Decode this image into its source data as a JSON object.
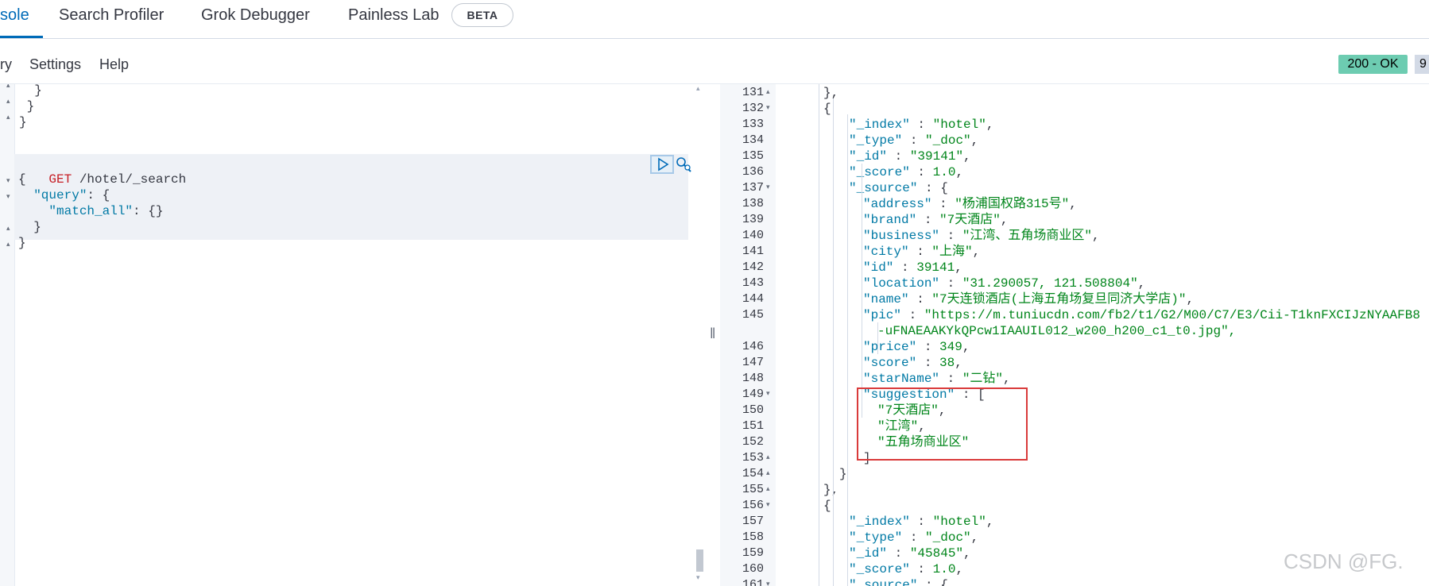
{
  "tabs": {
    "console": "sole",
    "search_profiler": "Search Profiler",
    "grok_debugger": "Grok Debugger",
    "painless_lab": "Painless Lab",
    "beta_badge": "BETA"
  },
  "menu": {
    "history": "ry",
    "settings": "Settings",
    "help": "Help"
  },
  "status": {
    "code": "200 - OK",
    "time": "9"
  },
  "request_editor": {
    "prev_lines": [
      "  }",
      " }",
      "}"
    ],
    "method": "GET",
    "path": " /hotel/_search",
    "body": {
      "open": "{",
      "query_key": "\"query\"",
      "query_open": ": {",
      "match_all_key": "\"match_all\"",
      "match_all_val": ": {}",
      "query_close": "  }",
      "close": "}"
    }
  },
  "response": {
    "lines": [
      {
        "n": "131",
        "fold": "up",
        "text": "},"
      },
      {
        "n": "132",
        "fold": "down",
        "text": "{"
      },
      {
        "n": "133",
        "k": "\"_index\"",
        "v": "\"hotel\"",
        "t": ","
      },
      {
        "n": "134",
        "k": "\"_type\"",
        "v": "\"_doc\"",
        "t": ","
      },
      {
        "n": "135",
        "k": "\"_id\"",
        "v": "\"39141\"",
        "t": ","
      },
      {
        "n": "136",
        "k": "\"_score\"",
        "v": "1.0",
        "t": ","
      },
      {
        "n": "137",
        "fold": "down",
        "k": "\"_source\"",
        "v": "{",
        "t": ""
      },
      {
        "n": "138",
        "k": "\"address\"",
        "v": "\"杨浦国权路315号\"",
        "t": ","
      },
      {
        "n": "139",
        "k": "\"brand\"",
        "v": "\"7天酒店\"",
        "t": ","
      },
      {
        "n": "140",
        "k": "\"business\"",
        "v": "\"江湾、五角场商业区\"",
        "t": ","
      },
      {
        "n": "141",
        "k": "\"city\"",
        "v": "\"上海\"",
        "t": ","
      },
      {
        "n": "142",
        "k": "\"id\"",
        "v": "39141",
        "t": ","
      },
      {
        "n": "143",
        "k": "\"location\"",
        "v": "\"31.290057, 121.508804\"",
        "t": ","
      },
      {
        "n": "144",
        "k": "\"name\"",
        "v": "\"7天连锁酒店(上海五角场复旦同济大学店)\"",
        "t": ","
      },
      {
        "n": "145",
        "k": "\"pic\"",
        "v": "\"https://m.tuniucdn.com/fb2/t1/G2/M00/C7/E3/Cii-T1knFXCIJzNYAAFB8",
        "t": ""
      },
      {
        "n": "",
        "cont": "-uFNAEAAKYkQPcw1IAAUIL012_w200_h200_c1_t0.jpg\","
      },
      {
        "n": "146",
        "k": "\"price\"",
        "v": "349",
        "t": ","
      },
      {
        "n": "147",
        "k": "\"score\"",
        "v": "38",
        "t": ","
      },
      {
        "n": "148",
        "k": "\"starName\"",
        "v": "\"二钻\"",
        "t": ","
      },
      {
        "n": "149",
        "fold": "down",
        "k": "\"suggestion\"",
        "v": "[",
        "t": ""
      },
      {
        "n": "150",
        "s": "\"7天酒店\"",
        "t": ","
      },
      {
        "n": "151",
        "s": "\"江湾\"",
        "t": ","
      },
      {
        "n": "152",
        "s": "\"五角场商业区\"",
        "t": ""
      },
      {
        "n": "153",
        "fold": "up",
        "text": "]"
      },
      {
        "n": "154",
        "fold": "up",
        "text": "}"
      },
      {
        "n": "155",
        "fold": "up",
        "text": "},"
      },
      {
        "n": "156",
        "fold": "down",
        "text": "{"
      },
      {
        "n": "157",
        "k": "\"_index\"",
        "v": "\"hotel\"",
        "t": ","
      },
      {
        "n": "158",
        "k": "\"_type\"",
        "v": "\"_doc\"",
        "t": ","
      },
      {
        "n": "159",
        "k": "\"_id\"",
        "v": "\"45845\"",
        "t": ","
      },
      {
        "n": "160",
        "k": "\"_score\"",
        "v": "1.0",
        "t": ","
      },
      {
        "n": "161",
        "fold": "down",
        "k": "\"_source\"",
        "v": "{",
        "t": ""
      }
    ]
  },
  "watermark": "CSDN @FG."
}
